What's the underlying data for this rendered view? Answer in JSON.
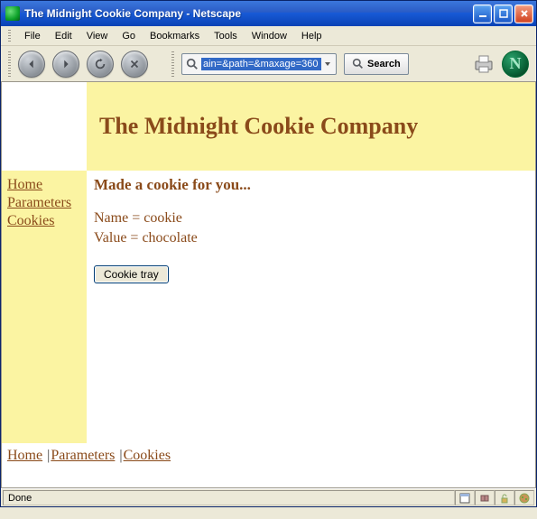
{
  "window": {
    "title": "The Midnight Cookie Company - Netscape"
  },
  "menubar": {
    "items": [
      "File",
      "Edit",
      "View",
      "Go",
      "Bookmarks",
      "Tools",
      "Window",
      "Help"
    ]
  },
  "toolbar": {
    "address_value": "ain=&path=&maxage=360",
    "search_label": "Search"
  },
  "page": {
    "banner_title": "The Midnight Cookie Company",
    "sidebar": {
      "links": [
        "Home",
        "Parameters",
        "Cookies"
      ]
    },
    "main": {
      "heading": "Made a cookie for you...",
      "name_line": "Name = cookie",
      "value_line": "Value = chocolate",
      "button_label": "Cookie tray"
    },
    "footer": {
      "links": [
        "Home",
        "Parameters",
        "Cookies"
      ]
    }
  },
  "statusbar": {
    "text": "Done"
  }
}
